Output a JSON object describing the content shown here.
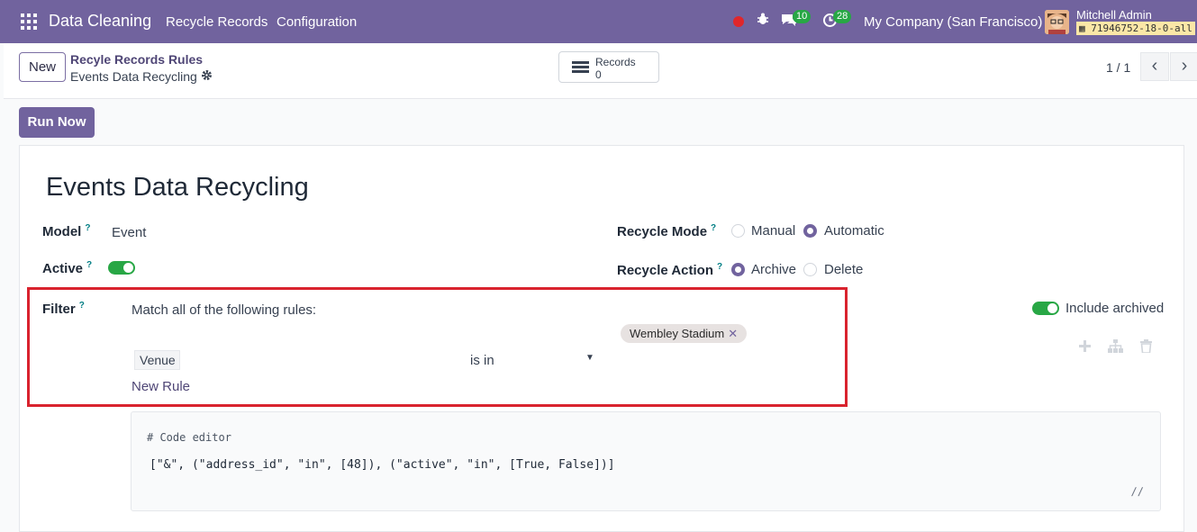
{
  "navbar": {
    "app_name": "Data Cleaning",
    "menu": [
      "Recycle Records",
      "Configuration"
    ],
    "messages_count": "10",
    "activities_count": "28",
    "company": "My Company (San Francisco)",
    "user_name": "Mitchell Admin",
    "database": "71946752-18-0-all"
  },
  "control": {
    "new_label": "New",
    "breadcrumb_parent": "Recyle Records Rules",
    "breadcrumb_current": "Events Data Recycling",
    "records_label": "Records",
    "records_count": "0",
    "pager": "1 / 1"
  },
  "actions": {
    "run_now": "Run Now"
  },
  "form": {
    "title": "Events Data Recycling",
    "model_label": "Model",
    "model_value": "Event",
    "active_label": "Active",
    "active_value": true,
    "recycle_mode_label": "Recycle Mode",
    "recycle_mode_options": [
      "Manual",
      "Automatic"
    ],
    "recycle_mode_selected": "Automatic",
    "recycle_action_label": "Recycle Action",
    "recycle_action_options": [
      "Archive",
      "Delete"
    ],
    "recycle_action_selected": "Archive",
    "help_mark": "?"
  },
  "filter": {
    "label": "Filter",
    "match_text": "Match all of the following rules:",
    "include_archived_label": "Include archived",
    "include_archived": true,
    "rule": {
      "field": "Venue",
      "operator": "is in",
      "value_tag": "Wembley Stadium"
    },
    "new_rule": "New Rule"
  },
  "code_editor": {
    "comment": "# Code editor",
    "domain": "[\"&\", (\"address_id\", \"in\", [48]), (\"active\", \"in\", [True, False])]"
  },
  "colors": {
    "brand": "#71639e",
    "success": "#28a745",
    "highlight": "#d9232e"
  }
}
